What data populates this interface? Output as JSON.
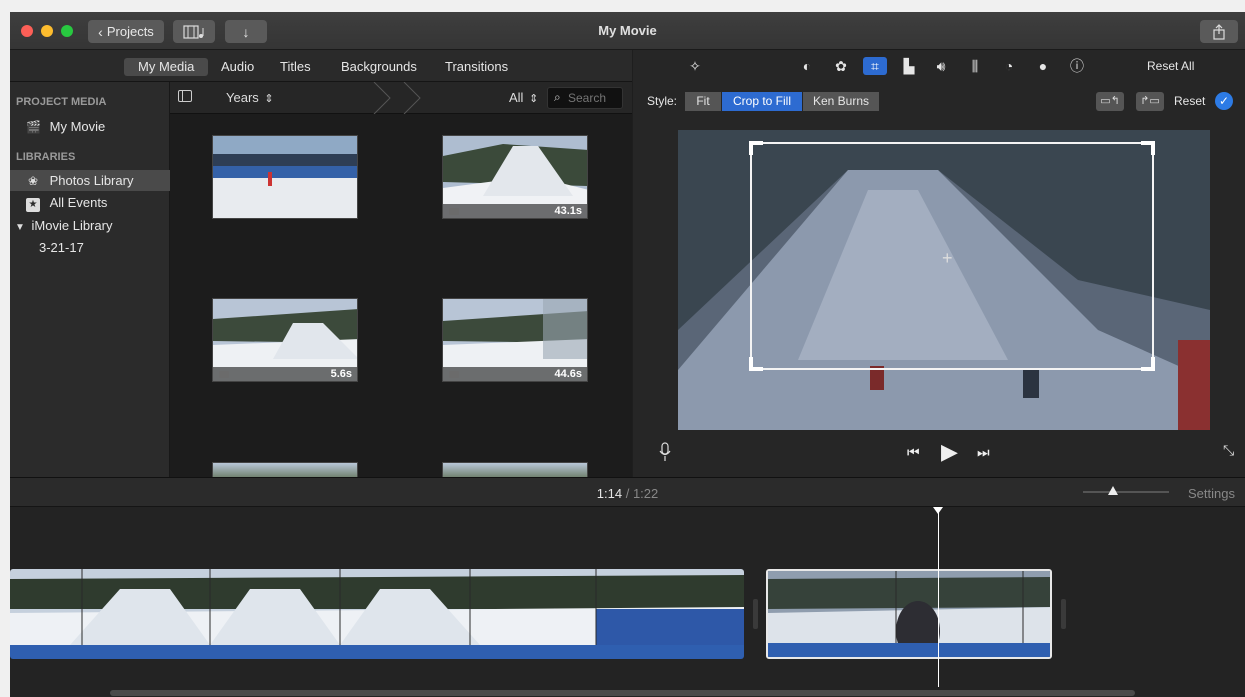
{
  "window": {
    "title": "My Movie",
    "projects_label": "Projects"
  },
  "media_tabs": [
    "My Media",
    "Audio",
    "Titles",
    "Backgrounds",
    "Transitions"
  ],
  "sidebar": {
    "project_media_head": "PROJECT MEDIA",
    "project_item": "My Movie",
    "libraries_head": "LIBRARIES",
    "items": [
      {
        "label": "Photos Library",
        "icon": "photos-icon",
        "selected": true
      },
      {
        "label": "All Events",
        "icon": "star-icon",
        "selected": false
      },
      {
        "label": "iMovie Library",
        "icon": "disclosure-triangle-icon",
        "selected": false
      },
      {
        "label": "3-21-17",
        "icon": "",
        "selected": false
      }
    ]
  },
  "browser": {
    "grouping": "Years",
    "filter": "All",
    "search_placeholder": "Search",
    "clips": [
      {
        "duration": "",
        "video": false
      },
      {
        "duration": "43.1s",
        "video": true
      },
      {
        "duration": "5.6s",
        "video": true
      },
      {
        "duration": "44.6s",
        "video": true
      }
    ]
  },
  "viewer": {
    "reset_all": "Reset All",
    "style_label": "Style:",
    "styles": [
      "Fit",
      "Crop to Fill",
      "Ken Burns"
    ],
    "active_style": "Crop to Fill",
    "reset": "Reset"
  },
  "timeline": {
    "current_time": "1:14",
    "separator": "/",
    "total_time": "1:22",
    "settings": "Settings"
  },
  "colors": {
    "accent": "#2d6bd1",
    "audio": "#2f5fb0"
  }
}
